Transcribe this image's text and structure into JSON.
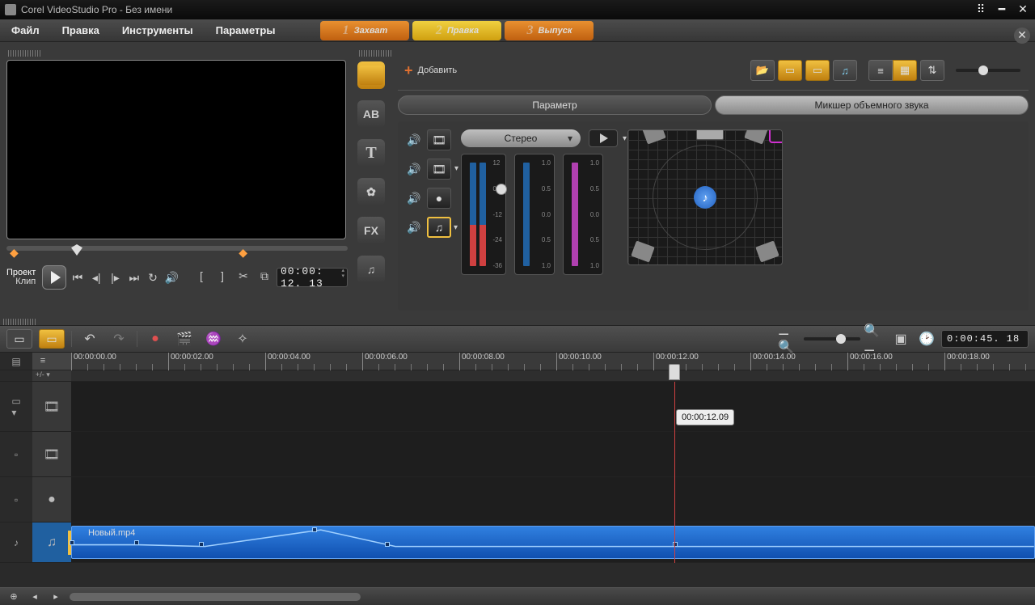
{
  "title": "Corel VideoStudio Pro - Без имени",
  "menu": {
    "file": "Файл",
    "edit": "Правка",
    "tools": "Инструменты",
    "settings": "Параметры"
  },
  "steps": {
    "s1": "Захват",
    "s2": "Правка",
    "s3": "Выпуск",
    "n1": "1",
    "n2": "2",
    "n3": "3"
  },
  "preview": {
    "project": "Проект",
    "clip": "Клип",
    "timecode": "00:00: 12. 13"
  },
  "library": {
    "add": "Добавить",
    "side": {
      "ab": "AB",
      "t": "T",
      "fx": "FX"
    }
  },
  "panel": {
    "tab1": "Параметр",
    "tab2": "Микшер объемного звука"
  },
  "mixer": {
    "stereo": "Стерео",
    "scale_big": [
      "12",
      "0",
      "-12",
      "-24",
      "-36"
    ],
    "scale_small": [
      "1.0",
      "0.5",
      "0.0",
      "0.5",
      "1.0"
    ]
  },
  "tl_toolbar": {
    "duration": "0:00:45. 18"
  },
  "ruler": [
    "00:00:00.00",
    "00:00:02.00",
    "00:00:04.00",
    "00:00:06.00",
    "00:00:08.00",
    "00:00:10.00",
    "00:00:12.00",
    "00:00:14.00",
    "00:00:16.00",
    "00:00:18.00"
  ],
  "playhead": {
    "tooltip": "00:00:12.09"
  },
  "clip": {
    "name": "Новый.mp4"
  },
  "plusminus": "+/- ▾"
}
